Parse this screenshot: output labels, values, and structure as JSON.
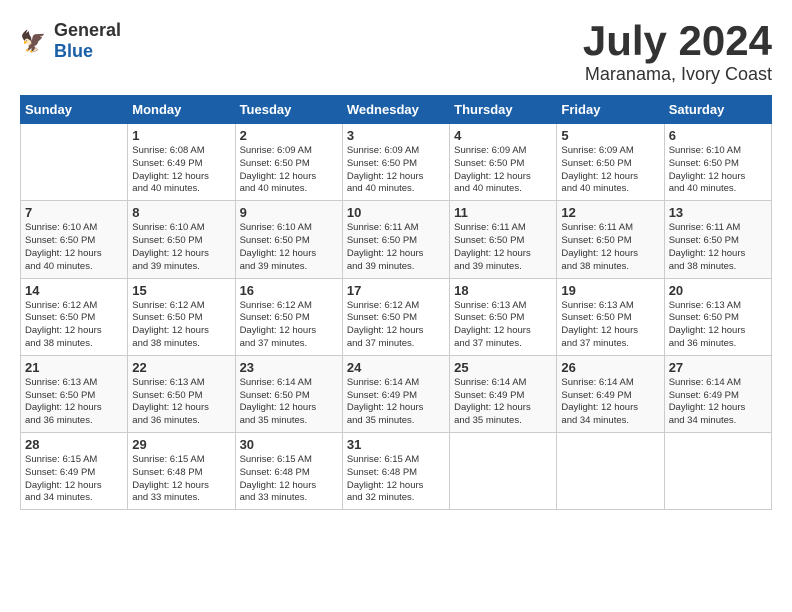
{
  "header": {
    "logo": {
      "general": "General",
      "blue": "Blue"
    },
    "title": "July 2024",
    "subtitle": "Maranama, Ivory Coast"
  },
  "calendar": {
    "days_of_week": [
      "Sunday",
      "Monday",
      "Tuesday",
      "Wednesday",
      "Thursday",
      "Friday",
      "Saturday"
    ],
    "weeks": [
      [
        {
          "day": "",
          "info": ""
        },
        {
          "day": "1",
          "info": "Sunrise: 6:08 AM\nSunset: 6:49 PM\nDaylight: 12 hours\nand 40 minutes."
        },
        {
          "day": "2",
          "info": "Sunrise: 6:09 AM\nSunset: 6:50 PM\nDaylight: 12 hours\nand 40 minutes."
        },
        {
          "day": "3",
          "info": "Sunrise: 6:09 AM\nSunset: 6:50 PM\nDaylight: 12 hours\nand 40 minutes."
        },
        {
          "day": "4",
          "info": "Sunrise: 6:09 AM\nSunset: 6:50 PM\nDaylight: 12 hours\nand 40 minutes."
        },
        {
          "day": "5",
          "info": "Sunrise: 6:09 AM\nSunset: 6:50 PM\nDaylight: 12 hours\nand 40 minutes."
        },
        {
          "day": "6",
          "info": "Sunrise: 6:10 AM\nSunset: 6:50 PM\nDaylight: 12 hours\nand 40 minutes."
        }
      ],
      [
        {
          "day": "7",
          "info": "Sunrise: 6:10 AM\nSunset: 6:50 PM\nDaylight: 12 hours\nand 40 minutes."
        },
        {
          "day": "8",
          "info": "Sunrise: 6:10 AM\nSunset: 6:50 PM\nDaylight: 12 hours\nand 39 minutes."
        },
        {
          "day": "9",
          "info": "Sunrise: 6:10 AM\nSunset: 6:50 PM\nDaylight: 12 hours\nand 39 minutes."
        },
        {
          "day": "10",
          "info": "Sunrise: 6:11 AM\nSunset: 6:50 PM\nDaylight: 12 hours\nand 39 minutes."
        },
        {
          "day": "11",
          "info": "Sunrise: 6:11 AM\nSunset: 6:50 PM\nDaylight: 12 hours\nand 39 minutes."
        },
        {
          "day": "12",
          "info": "Sunrise: 6:11 AM\nSunset: 6:50 PM\nDaylight: 12 hours\nand 38 minutes."
        },
        {
          "day": "13",
          "info": "Sunrise: 6:11 AM\nSunset: 6:50 PM\nDaylight: 12 hours\nand 38 minutes."
        }
      ],
      [
        {
          "day": "14",
          "info": "Sunrise: 6:12 AM\nSunset: 6:50 PM\nDaylight: 12 hours\nand 38 minutes."
        },
        {
          "day": "15",
          "info": "Sunrise: 6:12 AM\nSunset: 6:50 PM\nDaylight: 12 hours\nand 38 minutes."
        },
        {
          "day": "16",
          "info": "Sunrise: 6:12 AM\nSunset: 6:50 PM\nDaylight: 12 hours\nand 37 minutes."
        },
        {
          "day": "17",
          "info": "Sunrise: 6:12 AM\nSunset: 6:50 PM\nDaylight: 12 hours\nand 37 minutes."
        },
        {
          "day": "18",
          "info": "Sunrise: 6:13 AM\nSunset: 6:50 PM\nDaylight: 12 hours\nand 37 minutes."
        },
        {
          "day": "19",
          "info": "Sunrise: 6:13 AM\nSunset: 6:50 PM\nDaylight: 12 hours\nand 37 minutes."
        },
        {
          "day": "20",
          "info": "Sunrise: 6:13 AM\nSunset: 6:50 PM\nDaylight: 12 hours\nand 36 minutes."
        }
      ],
      [
        {
          "day": "21",
          "info": "Sunrise: 6:13 AM\nSunset: 6:50 PM\nDaylight: 12 hours\nand 36 minutes."
        },
        {
          "day": "22",
          "info": "Sunrise: 6:13 AM\nSunset: 6:50 PM\nDaylight: 12 hours\nand 36 minutes."
        },
        {
          "day": "23",
          "info": "Sunrise: 6:14 AM\nSunset: 6:50 PM\nDaylight: 12 hours\nand 35 minutes."
        },
        {
          "day": "24",
          "info": "Sunrise: 6:14 AM\nSunset: 6:49 PM\nDaylight: 12 hours\nand 35 minutes."
        },
        {
          "day": "25",
          "info": "Sunrise: 6:14 AM\nSunset: 6:49 PM\nDaylight: 12 hours\nand 35 minutes."
        },
        {
          "day": "26",
          "info": "Sunrise: 6:14 AM\nSunset: 6:49 PM\nDaylight: 12 hours\nand 34 minutes."
        },
        {
          "day": "27",
          "info": "Sunrise: 6:14 AM\nSunset: 6:49 PM\nDaylight: 12 hours\nand 34 minutes."
        }
      ],
      [
        {
          "day": "28",
          "info": "Sunrise: 6:15 AM\nSunset: 6:49 PM\nDaylight: 12 hours\nand 34 minutes."
        },
        {
          "day": "29",
          "info": "Sunrise: 6:15 AM\nSunset: 6:48 PM\nDaylight: 12 hours\nand 33 minutes."
        },
        {
          "day": "30",
          "info": "Sunrise: 6:15 AM\nSunset: 6:48 PM\nDaylight: 12 hours\nand 33 minutes."
        },
        {
          "day": "31",
          "info": "Sunrise: 6:15 AM\nSunset: 6:48 PM\nDaylight: 12 hours\nand 32 minutes."
        },
        {
          "day": "",
          "info": ""
        },
        {
          "day": "",
          "info": ""
        },
        {
          "day": "",
          "info": ""
        }
      ]
    ]
  }
}
